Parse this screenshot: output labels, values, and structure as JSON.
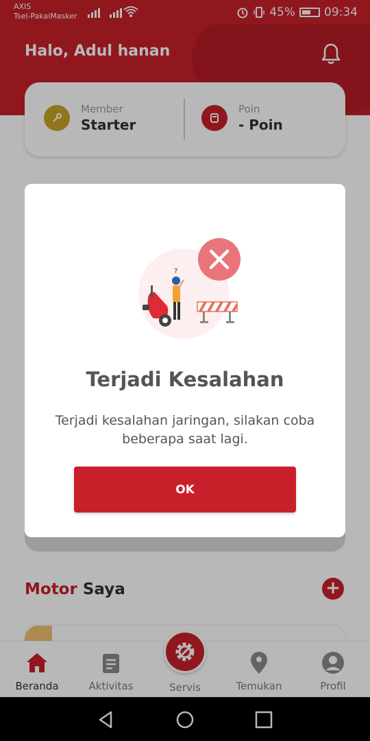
{
  "status_bar": {
    "carrier_1": "AXIS",
    "carrier_2": "Tsel-PakaiMasker",
    "battery": "45%",
    "time": "09:34"
  },
  "header": {
    "greeting": "Halo, Adul hanan"
  },
  "member_card": {
    "member_label": "Member",
    "member_value": "Starter",
    "poin_label": "Poin",
    "poin_value": "- Poin"
  },
  "motor_section": {
    "title_accent": "Motor",
    "title_rest": " Saya"
  },
  "bottom_nav": {
    "items": [
      {
        "label": "Beranda",
        "icon": "home-icon"
      },
      {
        "label": "Aktivitas",
        "icon": "clipboard-icon"
      },
      {
        "label": "Servis",
        "icon": "gear-icon"
      },
      {
        "label": "Temukan",
        "icon": "location-pin-icon"
      },
      {
        "label": "Profil",
        "icon": "profile-icon"
      }
    ]
  },
  "modal": {
    "title": "Terjadi Kesalahan",
    "message": "Terjadi kesalahan jaringan, silakan coba beberapa saat lagi.",
    "ok_label": "OK"
  },
  "colors": {
    "brand": "#c8202a",
    "text_dark": "#333333",
    "text_muted": "#9a9a9a"
  }
}
